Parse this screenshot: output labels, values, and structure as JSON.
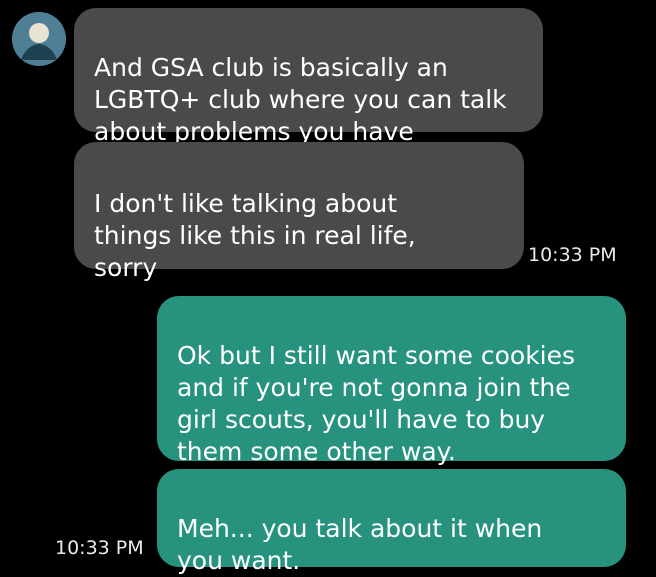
{
  "conversation": {
    "contact_avatar_icon": "profile-photo",
    "messages": [
      {
        "direction": "incoming",
        "text": "And GSA club is basically an\nLGBTQ+ club where you can talk\nabout problems you have"
      },
      {
        "direction": "incoming",
        "text": "I don't like talking about\nthings like this in real life,\nsorry"
      },
      {
        "direction": "outgoing",
        "text": "Ok but I still want some cookies\nand if you're not gonna join the\ngirl scouts, you'll have to buy\nthem some other way."
      },
      {
        "direction": "outgoing",
        "text": "Meh... you talk about it when\nyou want."
      }
    ],
    "timestamps": {
      "incoming_group": "10:33 PM",
      "outgoing_group": "10:33 PM"
    }
  },
  "colors": {
    "background": "#000000",
    "incoming_bubble": "#4a4a4a",
    "outgoing_bubble": "#27937f",
    "text": "#ffffff"
  }
}
